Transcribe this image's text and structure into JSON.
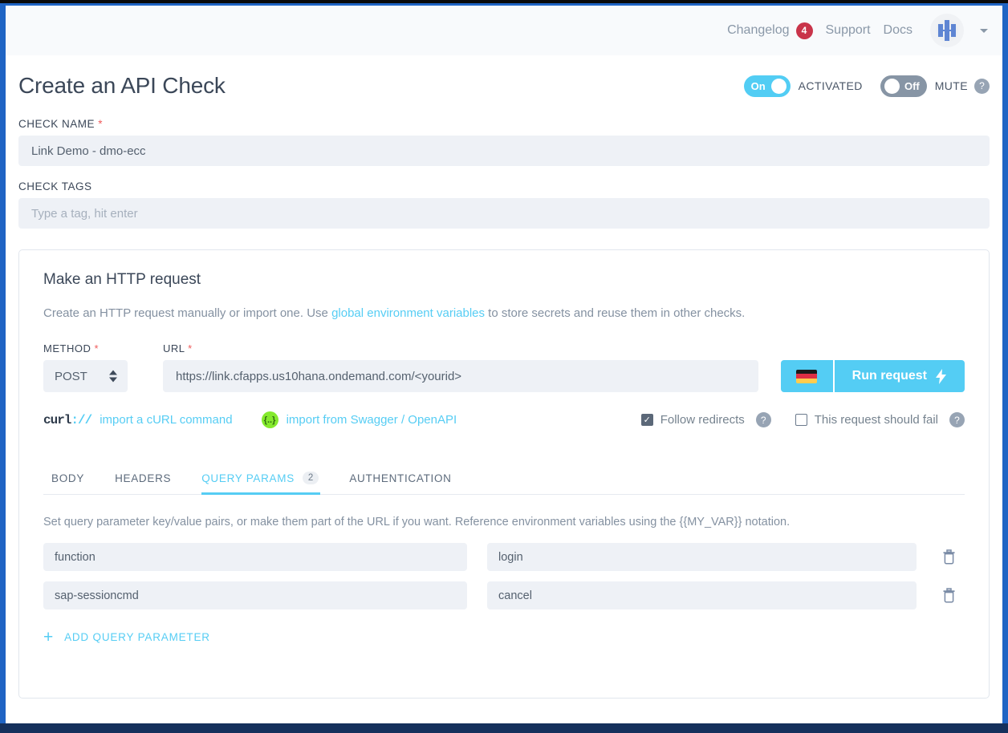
{
  "topbar": {
    "changelog": "Changelog",
    "changelog_count": "4",
    "support": "Support",
    "docs": "Docs"
  },
  "header": {
    "title": "Create an API Check",
    "activated_toggle": "On",
    "activated_label": "ACTIVATED",
    "mute_toggle": "Off",
    "mute_label": "MUTE",
    "help": "?"
  },
  "check_name": {
    "label": "CHECK NAME",
    "required": "*",
    "value": "Link Demo - dmo-ecc"
  },
  "check_tags": {
    "label": "CHECK TAGS",
    "value": "",
    "placeholder": "Type a tag, hit enter"
  },
  "request": {
    "title": "Make an HTTP request",
    "description_pre": "Create an HTTP request manually or import one. Use ",
    "description_link": "global environment variables",
    "description_post": " to store secrets and reuse them in other checks.",
    "method_label": "METHOD",
    "method_required": "*",
    "method_value": "POST",
    "url_label": "URL",
    "url_required": "*",
    "url_value": "https://link.cfapps.us10hana.ondemand.com/<yourid>",
    "url_placeholder": "",
    "flag_region": "de",
    "run_button": "Run request",
    "curl_logo": "curl",
    "curl_slashes": "://",
    "import_curl": "import a cURL command",
    "swagger_icon": "{..}",
    "import_swagger": "import from Swagger / OpenAPI",
    "follow_redirects": "Follow redirects",
    "follow_redirects_checked": true,
    "follow_redirects_help": "?",
    "should_fail": "This request should fail",
    "should_fail_checked": false,
    "should_fail_help": "?"
  },
  "tabs": [
    {
      "label": "BODY",
      "active": false,
      "count": ""
    },
    {
      "label": "HEADERS",
      "active": false,
      "count": ""
    },
    {
      "label": "QUERY PARAMS",
      "active": true,
      "count": "2"
    },
    {
      "label": "AUTHENTICATION",
      "active": false,
      "count": ""
    }
  ],
  "query_params": {
    "hint": "Set query parameter key/value pairs, or make them part of the URL if you want. Reference environment variables using the {{MY_VAR}} notation.",
    "rows": [
      {
        "key": "function",
        "value": "login"
      },
      {
        "key": "sap-sessioncmd",
        "value": "cancel"
      }
    ],
    "add_label": "ADD QUERY PARAMETER",
    "add_plus": "+"
  },
  "colors": {
    "accent": "#56cdf4",
    "frame_blue": "#1f64c4",
    "badge_red": "#c9344a",
    "text_dark": "#3b4758",
    "input_bg": "#eef1f6",
    "swagger_green": "#85ea2d"
  }
}
